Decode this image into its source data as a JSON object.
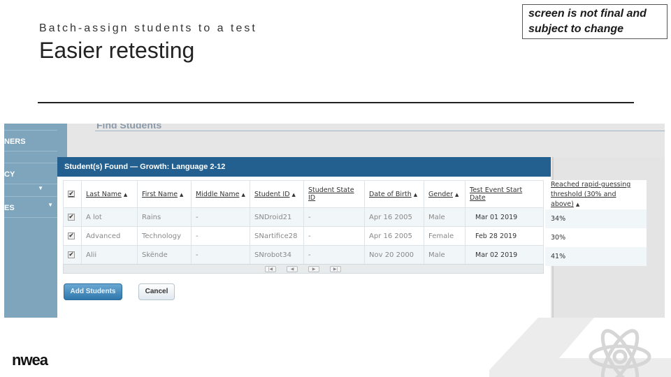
{
  "slide": {
    "subtitle": "Batch-assign students to a test",
    "title": "Easier retesting",
    "note": "screen is not final and subject to change",
    "logo": "nwea"
  },
  "sidebar": {
    "items": [
      "NERS",
      "",
      "CY",
      "",
      "ES"
    ]
  },
  "page": {
    "section": "Find Students"
  },
  "modal": {
    "header": "Student(s) Found —   Growth: Language 2-12",
    "columns": [
      "Last Name",
      "First Name",
      "Middle Name",
      "Student ID",
      "Student State ID",
      "Date of Birth",
      "Gender",
      "Test Event Start Date"
    ],
    "extra_column": {
      "line1": "Reached rapid-guessing",
      "line2": "threshold (30% and above)"
    },
    "rows": [
      {
        "checked": true,
        "last": "A lot",
        "first": "Rains",
        "middle": "-",
        "id": "SNDroid21",
        "state_id": "-",
        "dob": "Apr 16 2005",
        "gender": "Male",
        "start": "Mar 01 2019",
        "rg": "34%"
      },
      {
        "checked": true,
        "last": "Advanced",
        "first": "Technology",
        "middle": "-",
        "id": "SNartifice28",
        "state_id": "-",
        "dob": "Apr 16 2005",
        "gender": "Female",
        "start": "Feb 28 2019",
        "rg": "30%"
      },
      {
        "checked": true,
        "last": "Alii",
        "first": "Skënde",
        "middle": "-",
        "id": "SNrobot34",
        "state_id": "-",
        "dob": "Nov 20 2000",
        "gender": "Male",
        "start": "Mar 02 2019",
        "rg": "41%"
      }
    ],
    "add_label": "Add Students",
    "cancel_label": "Cancel"
  }
}
